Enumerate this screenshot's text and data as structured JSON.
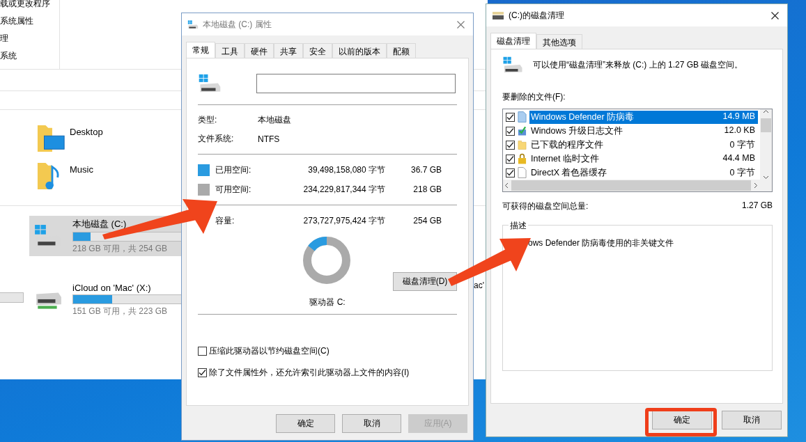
{
  "explorer": {
    "ribbon_items": [
      "载或更改程序",
      "系统属性",
      "理",
      "系统"
    ],
    "folders": [
      {
        "name": "Desktop",
        "kind": "desktop"
      },
      {
        "name": "Music",
        "kind": "music"
      }
    ],
    "drives": [
      {
        "name": "本地磁盘 (C:)",
        "kind": "local",
        "selected": true,
        "level": 0.16,
        "free_text": "218 GB 可用，共 254 GB"
      },
      {
        "name": "iCloud on 'Mac' (X:)",
        "kind": "network",
        "selected": false,
        "level": 0.36,
        "free_text": "151 GB 可用，共 223 GB"
      }
    ],
    "fragment": "ac'"
  },
  "properties": {
    "title": "本地磁盘 (C:) 属性",
    "tabs": [
      {
        "label": "常规",
        "selected": true
      },
      {
        "label": "工具",
        "selected": false
      },
      {
        "label": "硬件",
        "selected": false
      },
      {
        "label": "共享",
        "selected": false
      },
      {
        "label": "安全",
        "selected": false
      },
      {
        "label": "以前的版本",
        "selected": false
      },
      {
        "label": "配额",
        "selected": false
      }
    ],
    "info": [
      {
        "label": "类型:",
        "value": "本地磁盘"
      },
      {
        "label": "文件系统:",
        "value": "NTFS"
      }
    ],
    "space": [
      {
        "label": "已用空间:",
        "bytes": "39,498,158,080 字节",
        "size": "36.7 GB",
        "color": "#2a9be0"
      },
      {
        "label": "可用空间:",
        "bytes": "234,229,817,344 字节",
        "size": "218 GB",
        "color": "#aaaaaa"
      }
    ],
    "capacity": {
      "label": "容量:",
      "bytes": "273,727,975,424 字节",
      "size": "254 GB"
    },
    "drive_label": "驱动器 C:",
    "cleanup_button": "磁盘清理(D)",
    "checkboxes": [
      {
        "label": "压缩此驱动器以节约磁盘空间(C)",
        "checked": false
      },
      {
        "label": "除了文件属性外，还允许索引此驱动器上文件的内容(I)",
        "checked": true
      }
    ],
    "buttons": [
      {
        "label": "确定",
        "disabled": false
      },
      {
        "label": "取消",
        "disabled": false
      },
      {
        "label": "应用(A)",
        "disabled": true
      }
    ]
  },
  "cleanup": {
    "title": "(C:)的磁盘清理",
    "tabs": [
      {
        "label": "磁盘清理",
        "selected": true
      },
      {
        "label": "其他选项",
        "selected": false
      }
    ],
    "intro": "可以使用“磁盘清理”来释放  (C:) 上的 1.27 GB 磁盘空间。",
    "list_label": "要删除的文件(F):",
    "files": [
      {
        "name": "Windows Defender 防病毒",
        "size": "14.9 MB",
        "kind": "document",
        "checked": true,
        "selected": true
      },
      {
        "name": "Windows 升级日志文件",
        "size": "12.0 KB",
        "kind": "upgrade",
        "checked": true,
        "selected": false
      },
      {
        "name": "已下载的程序文件",
        "size": "0 字节",
        "kind": "folder",
        "checked": true,
        "selected": false
      },
      {
        "name": "Internet 临时文件",
        "size": "44.4 MB",
        "kind": "lock",
        "checked": true,
        "selected": false
      },
      {
        "name": "DirectX 着色器缓存",
        "size": "0 字节",
        "kind": "blank",
        "checked": true,
        "selected": false
      }
    ],
    "total_label": "可获得的磁盘空间总量:",
    "total_value": "1.27 GB",
    "description_legend": "描述",
    "description": "ows Defender 防病毒使用的非关键文件",
    "buttons": [
      {
        "label": "确定",
        "highlighted": true
      },
      {
        "label": "取消",
        "highlighted": false
      }
    ]
  }
}
